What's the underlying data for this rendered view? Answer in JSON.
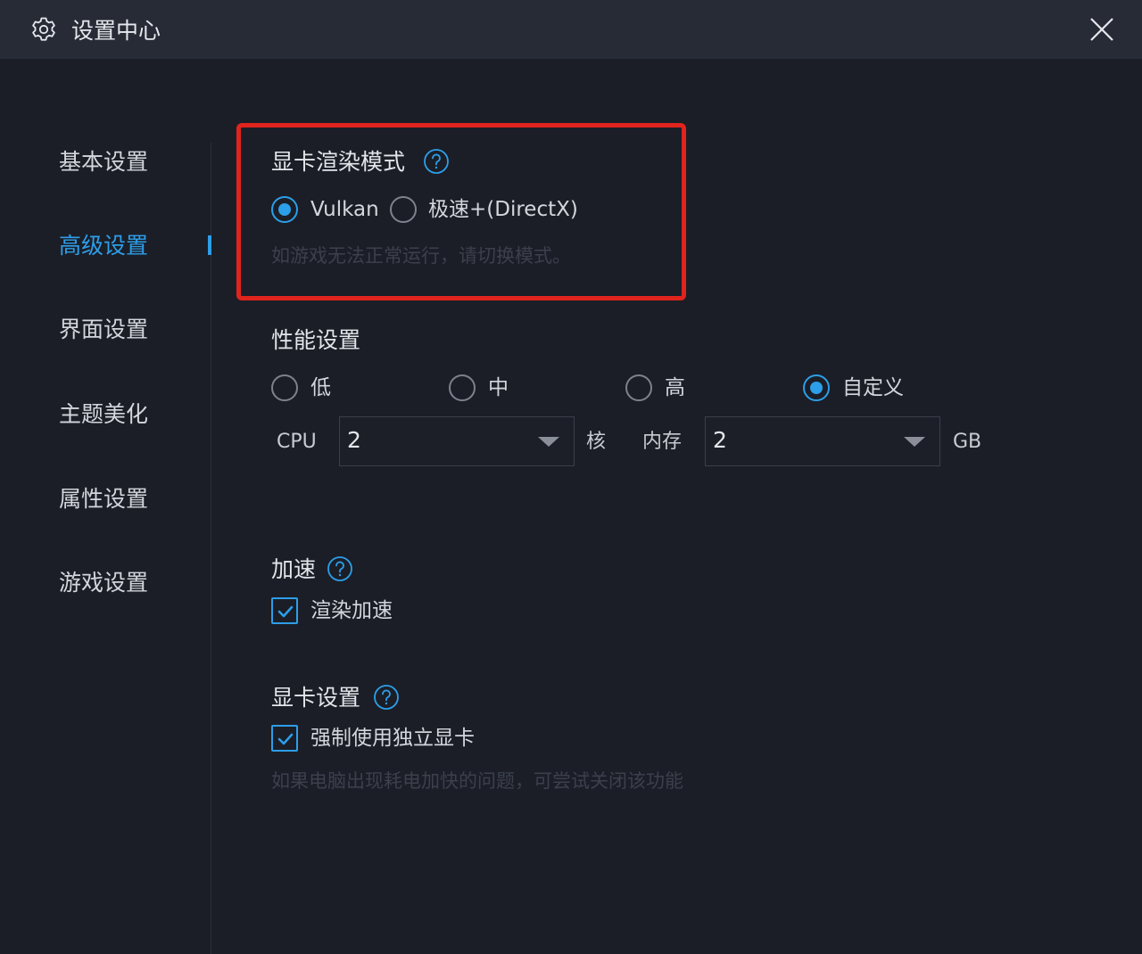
{
  "window": {
    "title": "设置中心",
    "icon": "gear-icon",
    "close_icon": "close-icon"
  },
  "sidebar": {
    "items": [
      {
        "label": "基本设置",
        "active": false
      },
      {
        "label": "高级设置",
        "active": true
      },
      {
        "label": "界面设置",
        "active": false
      },
      {
        "label": "主题美化",
        "active": false
      },
      {
        "label": "属性设置",
        "active": false
      },
      {
        "label": "游戏设置",
        "active": false
      }
    ]
  },
  "gpu_render": {
    "title": "显卡渲染模式",
    "options": [
      {
        "label": "Vulkan",
        "selected": true
      },
      {
        "label": "极速+(DirectX)",
        "selected": false
      }
    ],
    "hint": "如游戏无法正常运行，请切换模式。"
  },
  "performance": {
    "title": "性能设置",
    "options": [
      {
        "label": "低",
        "selected": false
      },
      {
        "label": "中",
        "selected": false
      },
      {
        "label": "高",
        "selected": false
      },
      {
        "label": "自定义",
        "selected": true
      }
    ],
    "cpu_label": "CPU",
    "cpu_value": "2",
    "cpu_unit": "核",
    "mem_label": "内存",
    "mem_value": "2",
    "mem_unit": "GB"
  },
  "acceleration": {
    "title": "加速",
    "checkbox_label": "渲染加速",
    "checked": true
  },
  "gpu_settings": {
    "title": "显卡设置",
    "checkbox_label": "强制使用独立显卡",
    "checked": true,
    "hint": "如果电脑出现耗电加快的问题，可尝试关闭该功能"
  },
  "colors": {
    "accent": "#2d9ee8",
    "background": "#1b1e27",
    "titlebar": "#272b36",
    "highlight": "#e0241d"
  }
}
